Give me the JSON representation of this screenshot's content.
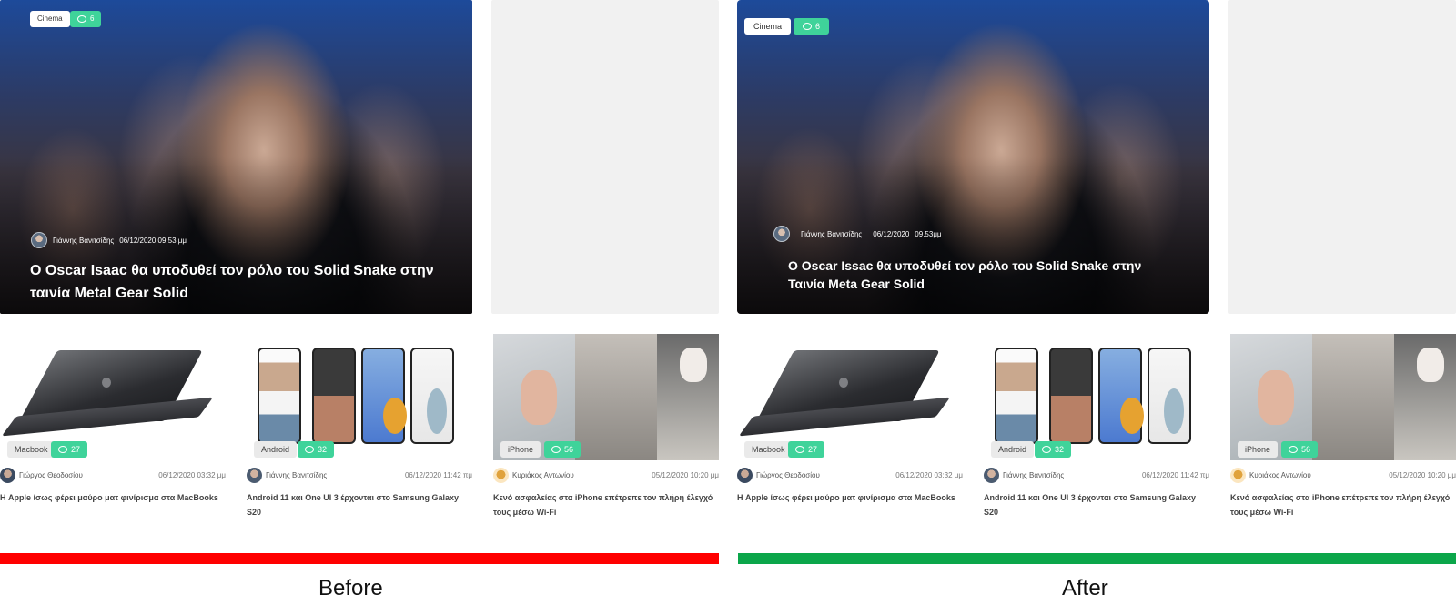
{
  "before": {
    "label": "Before",
    "hero": {
      "category": "Cinema",
      "comments": "6",
      "author": "Γιάννης Βανιτσίδης",
      "date": "06/12/2020 09:53 μμ",
      "title": "Ο Oscar Isaac θα υποδυθεί τον ρόλο του Solid Snake στην ταινία Metal Gear Solid"
    },
    "cards": [
      {
        "tag": "Macbook",
        "comments": "27",
        "author": "Γιώργος Θεοδοσίου",
        "date": "06/12/2020 03:32 μμ",
        "title": "Η Apple ίσως φέρει μαύρο ματ φινίρισμα στα MacBooks"
      },
      {
        "tag": "Android",
        "comments": "32",
        "author": "Γιάννης Βανιτσίδης",
        "date": "06/12/2020 11:42 πμ",
        "title": "Android 11 και One UI 3 έρχονται στο Samsung Galaxy S20"
      },
      {
        "tag": "iPhone",
        "comments": "56",
        "author": "Κυριάκος Αντωνίου",
        "date": "05/12/2020 10:20 μμ",
        "title": "Κενό ασφαλείας στα iPhone επέτρεπε τον πλήρη έλεγχό τους μέσω Wi-Fi"
      }
    ]
  },
  "after": {
    "label": "After",
    "hero": {
      "category": "Cinema",
      "comments": "6",
      "author": "Γιάννης Βανιτσίδης",
      "date": "06/12/2020",
      "time": "09.53μμ",
      "title": "Ο Oscar Issac θα υποδυθεί τον ρόλο του Solid Snake στην Ταινία Meta Gear Solid"
    },
    "cards": [
      {
        "tag": "Macbook",
        "comments": "27",
        "author": "Γιώργος Θεοδοσίου",
        "date": "06/12/2020 03:32 μμ",
        "title": "Η Apple ίσως φέρει μαύρο ματ φινίρισμα στα MacBooks"
      },
      {
        "tag": "Android",
        "comments": "32",
        "author": "Γιάννης Βανιτσίδης",
        "date": "06/12/2020 11:42 πμ",
        "title": "Android 11 και One UI 3 έρχονται στο Samsung Galaxy S20"
      },
      {
        "tag": "iPhone",
        "comments": "56",
        "author": "Κυριάκος Αντωνίου",
        "date": "05/12/2020 10:20 μμ",
        "title": "Κενό ασφαλείας στα iPhone επέτρεπε τον πλήρη έλεγχό τους μέσω Wi-Fi"
      }
    ]
  },
  "colors": {
    "before_bar": "#ff0000",
    "after_bar": "#0ba64a",
    "comment_chip": "#3fd39a"
  },
  "icons": {
    "comments": "speech-bubble-icon"
  }
}
